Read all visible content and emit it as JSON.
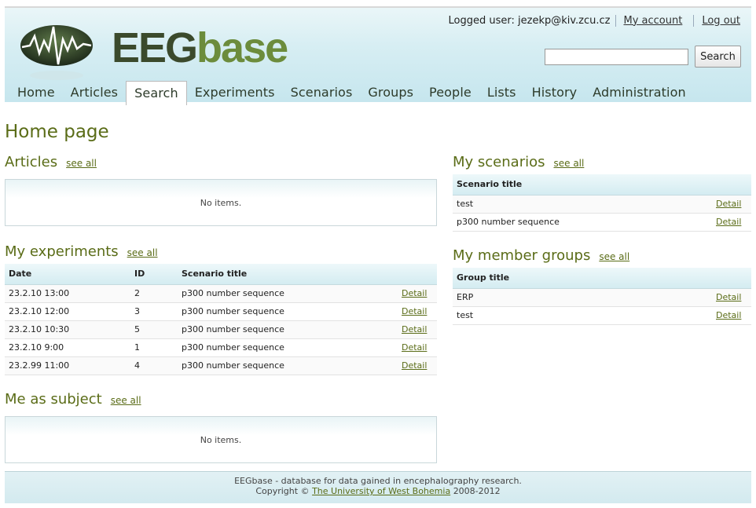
{
  "logo": {
    "part1": "EEG",
    "part2": "base"
  },
  "user": {
    "logged_label": "Logged user: jezekp@kiv.zcu.cz",
    "my_account": "My account",
    "logout": "Log out"
  },
  "search": {
    "value": "",
    "button": "Search"
  },
  "nav": [
    "Home",
    "Articles",
    "Search",
    "Experiments",
    "Scenarios",
    "Groups",
    "People",
    "Lists",
    "History",
    "Administration"
  ],
  "nav_active": "Search",
  "page_title": "Home page",
  "see_all": "see all",
  "articles": {
    "title": "Articles",
    "empty": "No items."
  },
  "experiments": {
    "title": "My experiments",
    "columns": [
      "Date",
      "ID",
      "Scenario title"
    ],
    "rows": [
      {
        "date": "23.2.10 13:00",
        "id": "2",
        "scenario": "p300 number sequence",
        "action": "Detail"
      },
      {
        "date": "23.2.10 12:00",
        "id": "3",
        "scenario": "p300 number sequence",
        "action": "Detail"
      },
      {
        "date": "23.2.10 10:30",
        "id": "5",
        "scenario": "p300 number sequence",
        "action": "Detail"
      },
      {
        "date": "23.2.10 9:00",
        "id": "1",
        "scenario": "p300 number sequence",
        "action": "Detail"
      },
      {
        "date": "23.2.99 11:00",
        "id": "4",
        "scenario": "p300 number sequence",
        "action": "Detail"
      }
    ]
  },
  "subject": {
    "title": "Me as subject",
    "empty": "No items."
  },
  "scenarios": {
    "title": "My scenarios",
    "column": "Scenario title",
    "rows": [
      {
        "title": "test",
        "action": "Detail"
      },
      {
        "title": "p300 number sequence",
        "action": "Detail"
      }
    ]
  },
  "groups": {
    "title": "My member groups",
    "column": "Group title",
    "rows": [
      {
        "title": "ERP",
        "action": "Detail"
      },
      {
        "title": "test",
        "action": "Detail"
      }
    ]
  },
  "footer": {
    "line1": "EEGbase - database for data gained in encephalography research.",
    "copyright_prefix": "Copyright ©",
    "university": "The University of West Bohemia",
    "years": "2008-2012"
  },
  "colors": {
    "accent_green": "#5a6c17",
    "header_blue": "#c6e6ee"
  }
}
